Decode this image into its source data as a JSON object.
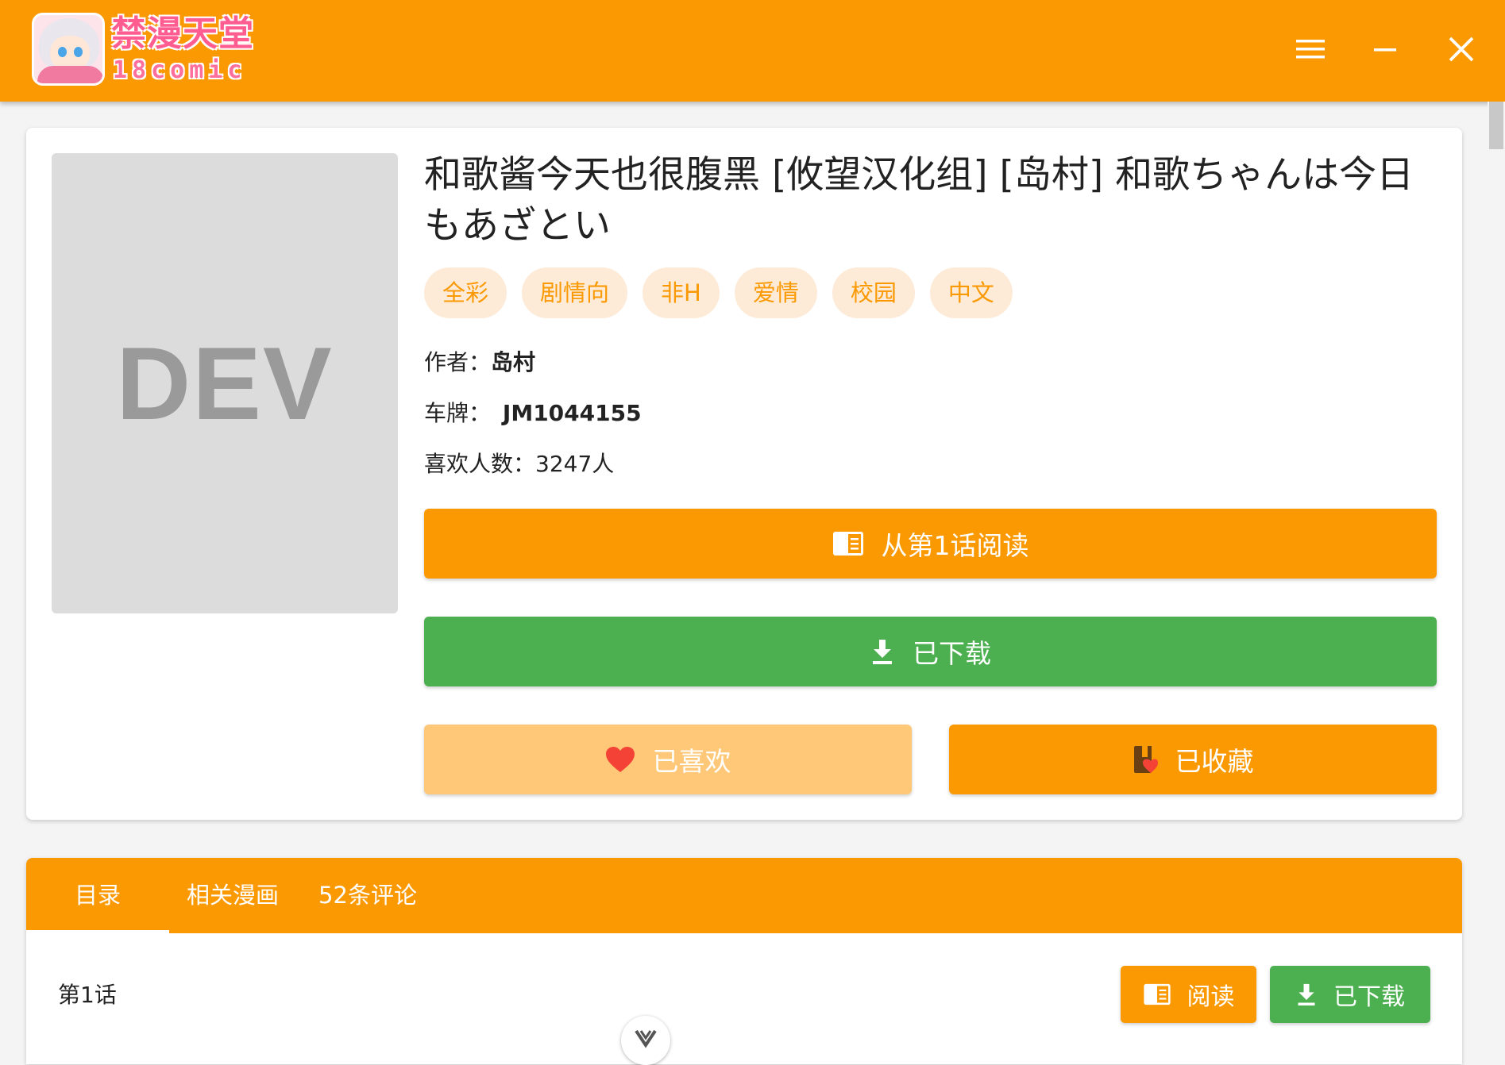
{
  "app": {
    "logo_title": "禁漫天堂",
    "logo_sub": "18comic",
    "accent_color": "#fb9902",
    "green_color": "#4caf50"
  },
  "cover": {
    "placeholder": "DEV"
  },
  "comic": {
    "title": "和歌酱今天也很腹黑 [攸望汉化组] [岛村] 和歌ちゃんは今日もあざとい",
    "tags": [
      "全彩",
      "剧情向",
      "非H",
      "爱情",
      "校园",
      "中文"
    ],
    "author_label": "作者：",
    "author": "岛村",
    "plate_label": "车牌：",
    "plate": "JM1044155",
    "likes_text": "喜欢人数：3247人"
  },
  "actions": {
    "read_from_first": "从第1话阅读",
    "downloaded": "已下载",
    "liked": "已喜欢",
    "favorited": "已收藏"
  },
  "tabs": [
    "目录",
    "相关漫画",
    "52条评论"
  ],
  "chapters": [
    {
      "label": "第1话",
      "read": "阅读",
      "download": "已下载"
    }
  ]
}
